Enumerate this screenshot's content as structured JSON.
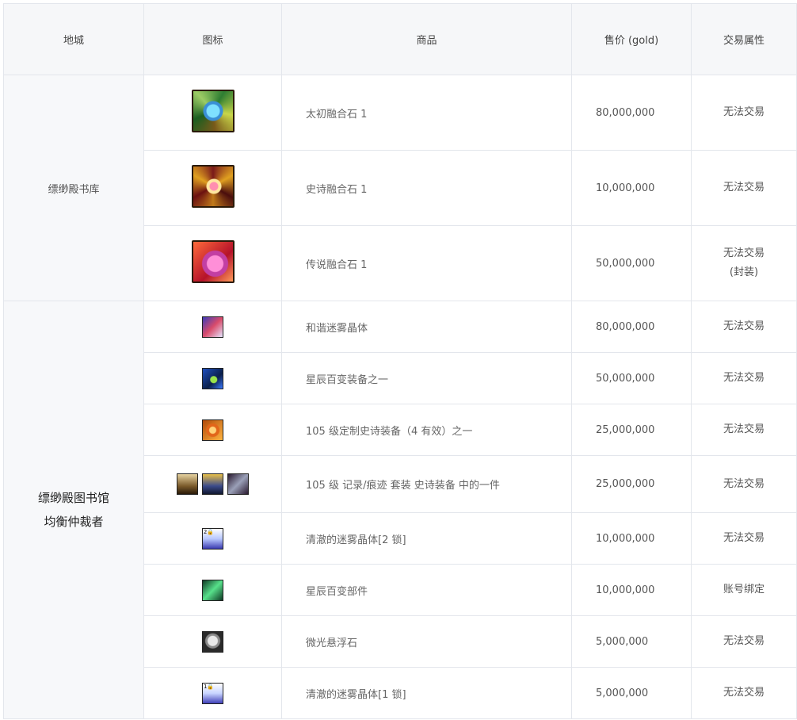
{
  "headers": {
    "city": "地城",
    "icon": "图标",
    "item": "商品",
    "price": "售价 (gold)",
    "attr": "交易属性"
  },
  "groups": [
    {
      "city": "缥缈殿书库",
      "rows": [
        {
          "icon": "primal-fusion-stone-icon",
          "name": "太初融合石 1",
          "price": "80,000,000",
          "attr": "无法交易"
        },
        {
          "icon": "epic-fusion-stone-icon",
          "name": "史诗融合石 1",
          "price": "10,000,000",
          "attr": "无法交易"
        },
        {
          "icon": "legendary-fusion-stone-icon",
          "name": "传说融合石 1",
          "price": "50,000,000",
          "attr": "无法交易",
          "attr2": "(封装)"
        }
      ]
    },
    {
      "city_line1": "缥缈殿图书馆",
      "city_line2": "均衡仲裁者",
      "rows": [
        {
          "icon": "harmony-mist-crystal-icon",
          "name": "和谐迷雾晶体",
          "price": "80,000,000",
          "attr": "无法交易"
        },
        {
          "icon": "star-equipment-icon",
          "name": "星辰百变装备之一",
          "price": "50,000,000",
          "attr": "无法交易"
        },
        {
          "icon": "custom-epic-icon",
          "name": "105 级定制史诗装备（4 有效）之一",
          "price": "25,000,000",
          "attr": "无法交易"
        },
        {
          "icon": "record-trace-set-icon",
          "name": "105 级 记录/痕迹 套装 史诗装备 中的一件",
          "price": "25,000,000",
          "attr": "无法交易"
        },
        {
          "icon": "clear-mist-crystal-2-lock-icon",
          "icon_label": "2🔒",
          "name": " 清澈的迷雾晶体[2 锁]",
          "price": "10,000,000",
          "attr": "无法交易"
        },
        {
          "icon": "star-part-icon",
          "name": "星辰百变部件",
          "price": "10,000,000",
          "attr": "账号绑定"
        },
        {
          "icon": "glimmer-floating-stone-icon",
          "name": "微光悬浮石",
          "price": "5,000,000",
          "attr": "无法交易"
        },
        {
          "icon": "clear-mist-crystal-1-lock-icon",
          "icon_label": "1🔒",
          "name": " 清澈的迷雾晶体[1 锁]",
          "price": "5,000,000",
          "attr": "无法交易"
        }
      ]
    }
  ]
}
